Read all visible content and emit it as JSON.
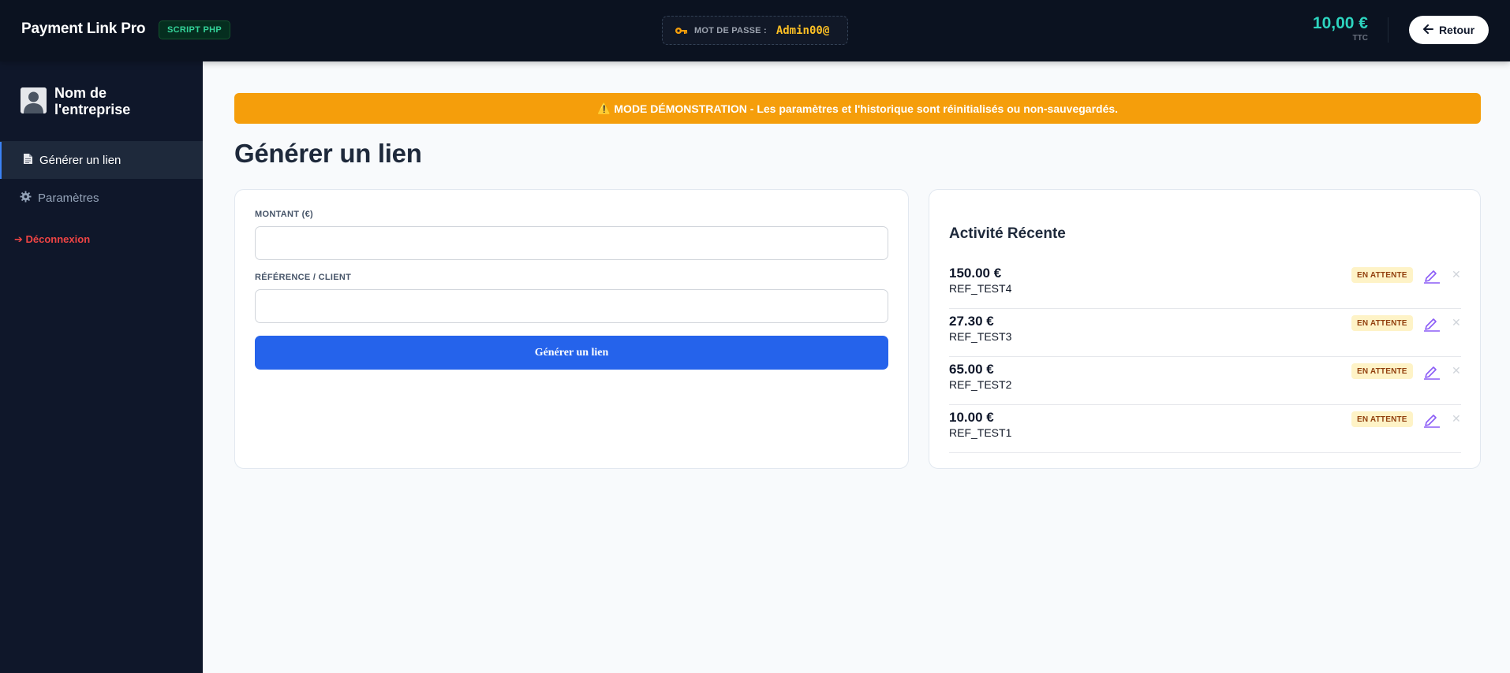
{
  "header": {
    "brand": "Payment Link Pro",
    "badge": "SCRIPT PHP",
    "password_label": "MOT DE PASSE :",
    "password_value": "Admin00@",
    "price": "10,00 €",
    "price_sub": "TTC",
    "back_label": "Retour"
  },
  "sidebar": {
    "company_name": "Nom de l'entreprise",
    "items": [
      {
        "label": "Générer un lien",
        "icon": "document-icon",
        "active": true
      },
      {
        "label": "Paramètres",
        "icon": "gear-icon",
        "active": false
      }
    ],
    "logout_label": "➔ Déconnexion"
  },
  "banner": {
    "icon": "⚠️",
    "text": "MODE DÉMONSTRATION - Les paramètres et l'historique sont réinitialisés ou non-sauvegardés."
  },
  "main": {
    "title": "Générer un lien",
    "form": {
      "amount_label": "MONTANT (€)",
      "amount_value": "",
      "reference_label": "RÉFÉRENCE / CLIENT",
      "reference_value": "",
      "submit_label": "Générer un lien"
    },
    "activity": {
      "title": "Activité Récente",
      "items": [
        {
          "amount": "150.00 €",
          "ref": "REF_TEST4",
          "status": "EN ATTENTE"
        },
        {
          "amount": "27.30 €",
          "ref": "REF_TEST3",
          "status": "EN ATTENTE"
        },
        {
          "amount": "65.00 €",
          "ref": "REF_TEST2",
          "status": "EN ATTENTE"
        },
        {
          "amount": "10.00 €",
          "ref": "REF_TEST1",
          "status": "EN ATTENTE"
        }
      ]
    }
  },
  "colors": {
    "topbar": "#0b1220",
    "sidebar": "#0f172a",
    "accent": "#2563eb",
    "warning": "#f59e0b",
    "price": "#2dd4bf",
    "password": "#fbbf24",
    "logout": "#ef4444"
  }
}
